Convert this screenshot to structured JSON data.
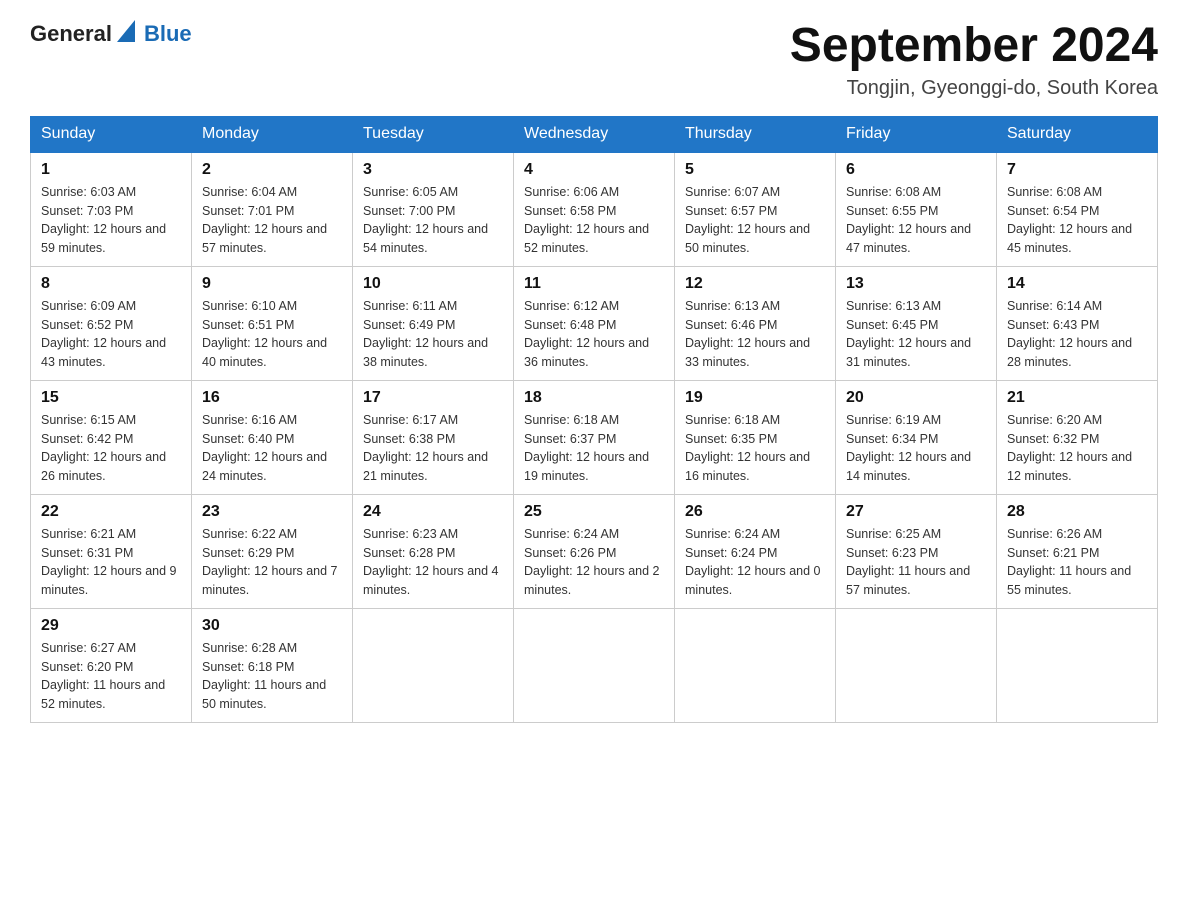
{
  "header": {
    "logo_general": "General",
    "logo_blue": "Blue",
    "title": "September 2024",
    "location": "Tongjin, Gyeonggi-do, South Korea"
  },
  "days_of_week": [
    "Sunday",
    "Monday",
    "Tuesday",
    "Wednesday",
    "Thursday",
    "Friday",
    "Saturday"
  ],
  "weeks": [
    [
      {
        "date": "1",
        "sunrise": "6:03 AM",
        "sunset": "7:03 PM",
        "daylight": "12 hours and 59 minutes."
      },
      {
        "date": "2",
        "sunrise": "6:04 AM",
        "sunset": "7:01 PM",
        "daylight": "12 hours and 57 minutes."
      },
      {
        "date": "3",
        "sunrise": "6:05 AM",
        "sunset": "7:00 PM",
        "daylight": "12 hours and 54 minutes."
      },
      {
        "date": "4",
        "sunrise": "6:06 AM",
        "sunset": "6:58 PM",
        "daylight": "12 hours and 52 minutes."
      },
      {
        "date": "5",
        "sunrise": "6:07 AM",
        "sunset": "6:57 PM",
        "daylight": "12 hours and 50 minutes."
      },
      {
        "date": "6",
        "sunrise": "6:08 AM",
        "sunset": "6:55 PM",
        "daylight": "12 hours and 47 minutes."
      },
      {
        "date": "7",
        "sunrise": "6:08 AM",
        "sunset": "6:54 PM",
        "daylight": "12 hours and 45 minutes."
      }
    ],
    [
      {
        "date": "8",
        "sunrise": "6:09 AM",
        "sunset": "6:52 PM",
        "daylight": "12 hours and 43 minutes."
      },
      {
        "date": "9",
        "sunrise": "6:10 AM",
        "sunset": "6:51 PM",
        "daylight": "12 hours and 40 minutes."
      },
      {
        "date": "10",
        "sunrise": "6:11 AM",
        "sunset": "6:49 PM",
        "daylight": "12 hours and 38 minutes."
      },
      {
        "date": "11",
        "sunrise": "6:12 AM",
        "sunset": "6:48 PM",
        "daylight": "12 hours and 36 minutes."
      },
      {
        "date": "12",
        "sunrise": "6:13 AM",
        "sunset": "6:46 PM",
        "daylight": "12 hours and 33 minutes."
      },
      {
        "date": "13",
        "sunrise": "6:13 AM",
        "sunset": "6:45 PM",
        "daylight": "12 hours and 31 minutes."
      },
      {
        "date": "14",
        "sunrise": "6:14 AM",
        "sunset": "6:43 PM",
        "daylight": "12 hours and 28 minutes."
      }
    ],
    [
      {
        "date": "15",
        "sunrise": "6:15 AM",
        "sunset": "6:42 PM",
        "daylight": "12 hours and 26 minutes."
      },
      {
        "date": "16",
        "sunrise": "6:16 AM",
        "sunset": "6:40 PM",
        "daylight": "12 hours and 24 minutes."
      },
      {
        "date": "17",
        "sunrise": "6:17 AM",
        "sunset": "6:38 PM",
        "daylight": "12 hours and 21 minutes."
      },
      {
        "date": "18",
        "sunrise": "6:18 AM",
        "sunset": "6:37 PM",
        "daylight": "12 hours and 19 minutes."
      },
      {
        "date": "19",
        "sunrise": "6:18 AM",
        "sunset": "6:35 PM",
        "daylight": "12 hours and 16 minutes."
      },
      {
        "date": "20",
        "sunrise": "6:19 AM",
        "sunset": "6:34 PM",
        "daylight": "12 hours and 14 minutes."
      },
      {
        "date": "21",
        "sunrise": "6:20 AM",
        "sunset": "6:32 PM",
        "daylight": "12 hours and 12 minutes."
      }
    ],
    [
      {
        "date": "22",
        "sunrise": "6:21 AM",
        "sunset": "6:31 PM",
        "daylight": "12 hours and 9 minutes."
      },
      {
        "date": "23",
        "sunrise": "6:22 AM",
        "sunset": "6:29 PM",
        "daylight": "12 hours and 7 minutes."
      },
      {
        "date": "24",
        "sunrise": "6:23 AM",
        "sunset": "6:28 PM",
        "daylight": "12 hours and 4 minutes."
      },
      {
        "date": "25",
        "sunrise": "6:24 AM",
        "sunset": "6:26 PM",
        "daylight": "12 hours and 2 minutes."
      },
      {
        "date": "26",
        "sunrise": "6:24 AM",
        "sunset": "6:24 PM",
        "daylight": "12 hours and 0 minutes."
      },
      {
        "date": "27",
        "sunrise": "6:25 AM",
        "sunset": "6:23 PM",
        "daylight": "11 hours and 57 minutes."
      },
      {
        "date": "28",
        "sunrise": "6:26 AM",
        "sunset": "6:21 PM",
        "daylight": "11 hours and 55 minutes."
      }
    ],
    [
      {
        "date": "29",
        "sunrise": "6:27 AM",
        "sunset": "6:20 PM",
        "daylight": "11 hours and 52 minutes."
      },
      {
        "date": "30",
        "sunrise": "6:28 AM",
        "sunset": "6:18 PM",
        "daylight": "11 hours and 50 minutes."
      },
      null,
      null,
      null,
      null,
      null
    ]
  ],
  "labels": {
    "sunrise": "Sunrise:",
    "sunset": "Sunset:",
    "daylight": "Daylight:"
  }
}
